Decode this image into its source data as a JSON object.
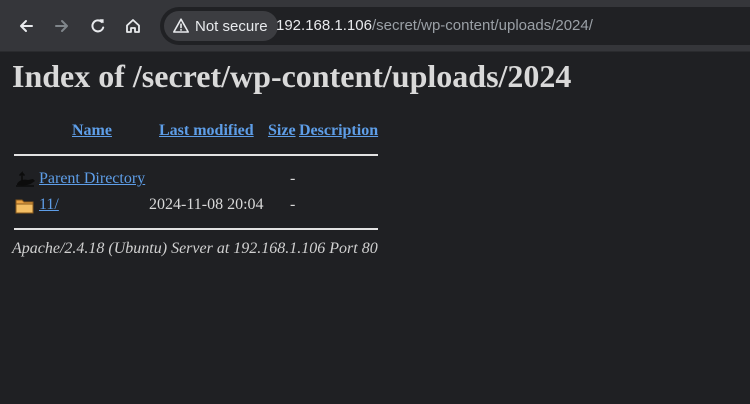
{
  "browser": {
    "security_label": "Not secure",
    "url_host": "192.168.1.106",
    "url_path": "/secret/wp-content/uploads/2024/",
    "icons": {
      "back": "arrow-left-icon",
      "forward": "arrow-right-icon",
      "reload": "reload-icon",
      "home": "home-icon",
      "security": "warning-triangle-icon"
    }
  },
  "page": {
    "title": "Index of /secret/wp-content/uploads/2024",
    "columns": {
      "name": "Name",
      "last_modified": "Last modified",
      "size": "Size",
      "description": "Description"
    },
    "entries": [
      {
        "icon": "parent-directory-icon",
        "name": "Parent Directory",
        "last_modified": "",
        "size": "-",
        "description": ""
      },
      {
        "icon": "folder-icon",
        "name": "11/",
        "last_modified": "2024-11-08 20:04",
        "size": "-",
        "description": ""
      }
    ],
    "server_signature": "Apache/2.4.18 (Ubuntu) Server at 192.168.1.106 Port 80"
  },
  "colors": {
    "page_background": "#1f2023",
    "toolbar_background": "#35363a",
    "link": "#5e9ee8",
    "text": "#d8d8d8"
  }
}
